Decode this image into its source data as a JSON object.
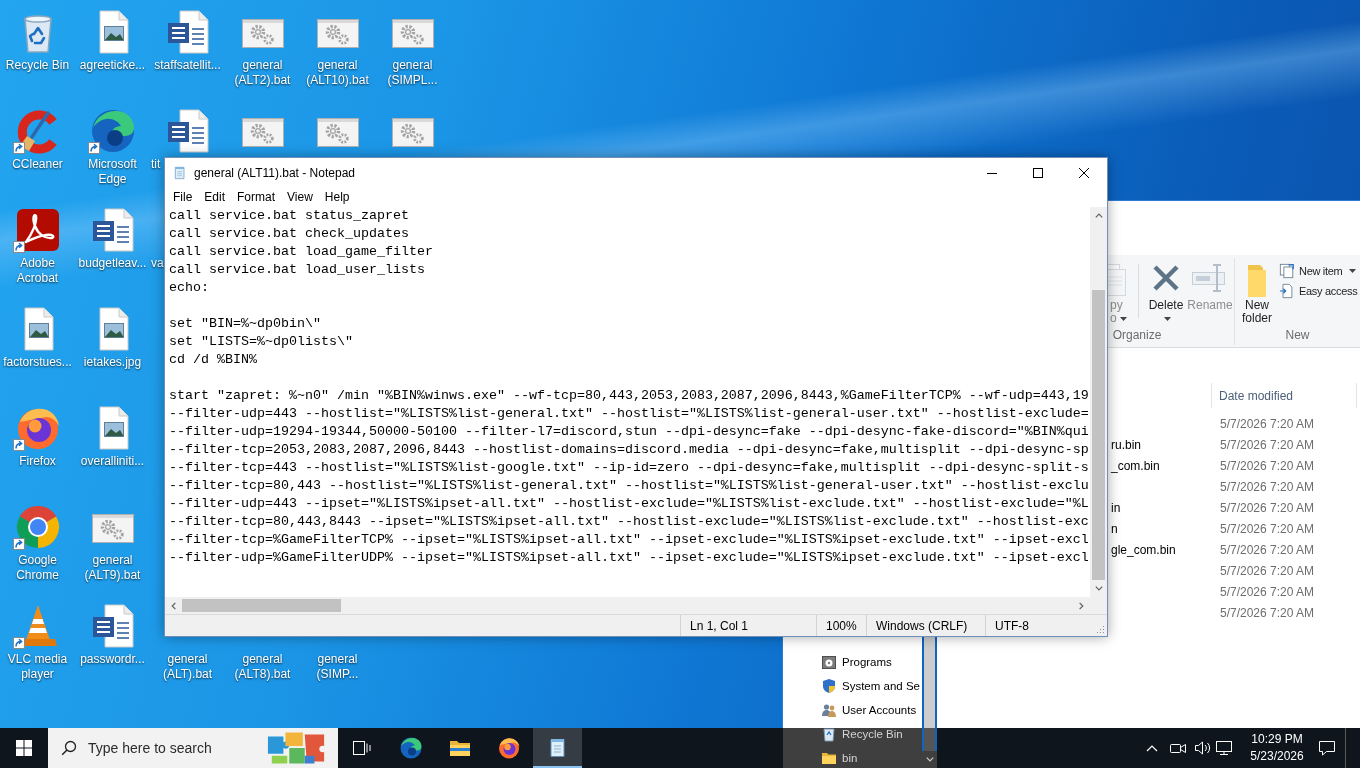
{
  "desktop": {
    "rows": [
      [
        {
          "label": "Recycle Bin",
          "kind": "recycle-bin",
          "shortcut": false,
          "clipped": false
        },
        {
          "label": "agreeticke...",
          "kind": "image",
          "shortcut": false,
          "clipped": false
        },
        {
          "label": "staffsatellit...",
          "kind": "word",
          "shortcut": false,
          "clipped": false
        },
        {
          "label": "general (ALT2).bat",
          "kind": "batch",
          "shortcut": false,
          "clipped": false
        },
        {
          "label": "general (ALT10).bat",
          "kind": "batch",
          "shortcut": false,
          "clipped": false
        },
        {
          "label": "general (SIMPL...",
          "kind": "batch",
          "shortcut": false,
          "clipped": false
        }
      ],
      [
        {
          "label": "CCleaner",
          "kind": "ccleaner",
          "shortcut": true,
          "clipped": false
        },
        {
          "label": "Microsoft Edge",
          "kind": "edge",
          "shortcut": true,
          "clipped": false
        },
        {
          "label": "tit",
          "kind": "word",
          "shortcut": false,
          "clipped": true
        },
        {
          "kind": "batch",
          "shortcut": false
        },
        {
          "kind": "batch",
          "shortcut": false
        },
        {
          "kind": "batch",
          "shortcut": false
        }
      ],
      [
        {
          "label": "Adobe Acrobat",
          "kind": "acrobat",
          "shortcut": true,
          "clipped": false
        },
        {
          "label": "budgetleav...",
          "kind": "word",
          "shortcut": false,
          "clipped": false
        },
        {
          "label": "va",
          "clipped": true
        }
      ],
      [
        {
          "label": "factorstues...",
          "kind": "image",
          "shortcut": false,
          "clipped": false
        },
        {
          "label": "ietakes.jpg",
          "kind": "image",
          "shortcut": false,
          "clipped": false
        }
      ],
      [
        {
          "label": "Firefox",
          "kind": "firefox",
          "shortcut": true,
          "clipped": false
        },
        {
          "label": "overalliniti...",
          "kind": "image",
          "shortcut": false,
          "clipped": false
        }
      ],
      [
        {
          "label": "Google Chrome",
          "kind": "chrome",
          "shortcut": true,
          "clipped": false
        },
        {
          "label": "general (ALT9).bat",
          "kind": "batch",
          "shortcut": false,
          "clipped": false
        }
      ],
      [
        {
          "label": "VLC media player",
          "kind": "vlc",
          "shortcut": true,
          "clipped": false
        },
        {
          "label": "passwordr...",
          "kind": "word",
          "shortcut": false,
          "clipped": false
        },
        {
          "label": "general (ALT).bat",
          "clipped": false
        },
        {
          "label": "general (ALT8).bat",
          "clipped": false
        },
        {
          "label": "general (SIMP...",
          "clipped": false
        }
      ]
    ]
  },
  "explorer": {
    "ribbon": {
      "groups": [
        {
          "label": "Organize",
          "items": [
            {
              "kind": "copy-to",
              "label": "py o",
              "dropdown": true,
              "disabled": true
            },
            {
              "kind": "delete",
              "label": "Delete",
              "dropdown": true,
              "disabled": false
            },
            {
              "kind": "rename",
              "label": "Rename",
              "dropdown": false,
              "disabled": true
            }
          ]
        },
        {
          "label": "New",
          "items": [
            {
              "kind": "new-folder",
              "label": "New folder",
              "dropdown": false,
              "disabled": false
            }
          ],
          "small_items": [
            {
              "kind": "new-item",
              "label": "New item",
              "dropdown": true
            },
            {
              "kind": "easy-access",
              "label": "Easy access",
              "dropdown": false
            }
          ]
        }
      ]
    },
    "nav_pane": {
      "items": [
        {
          "label": "Programs",
          "kind": "programs"
        },
        {
          "label": "System and Se",
          "kind": "shield"
        },
        {
          "label": "User Accounts",
          "kind": "users"
        },
        {
          "label": "Recycle Bin",
          "kind": "recycle-bin"
        },
        {
          "label": "bin",
          "kind": "folder"
        }
      ]
    },
    "file_list": {
      "column_header": "Date modified",
      "rows": [
        {
          "date_modified": "5/7/2026 7:20 AM"
        },
        {
          "name": "ru.bin",
          "date_modified": "5/7/2026 7:20 AM"
        },
        {
          "name": "_com.bin",
          "date_modified": "5/7/2026 7:20 AM"
        },
        {
          "date_modified": "5/7/2026 7:20 AM"
        },
        {
          "name": "in",
          "date_modified": "5/7/2026 7:20 AM"
        },
        {
          "name": "n",
          "date_modified": "5/7/2026 7:20 AM"
        },
        {
          "name": "gle_com.bin",
          "date_modified": "5/7/2026 7:20 AM"
        },
        {
          "date_modified": "5/7/2026 7:20 AM"
        },
        {
          "date_modified": "5/7/2026 7:20 AM"
        },
        {
          "date_modified": "5/7/2026 7:20 AM"
        }
      ]
    }
  },
  "notepad": {
    "title": "general (ALT11).bat - Notepad",
    "menu": [
      "File",
      "Edit",
      "Format",
      "View",
      "Help"
    ],
    "content": "call service.bat status_zapret\ncall service.bat check_updates\ncall service.bat load_game_filter\ncall service.bat load_user_lists\necho:\n\nset \"BIN=%~dp0bin\\\"\nset \"LISTS=%~dp0lists\\\"\ncd /d %BIN%\n\nstart \"zapret: %~n0\" /min \"%BIN%winws.exe\" --wf-tcp=80,443,2053,2083,2087,2096,8443,%GameFilterTCP% --wf-udp=443,19\n--filter-udp=443 --hostlist=\"%LISTS%list-general.txt\" --hostlist=\"%LISTS%list-general-user.txt\" --hostlist-exclude=\n--filter-udp=19294-19344,50000-50100 --filter-l7=discord,stun --dpi-desync=fake --dpi-desync-fake-discord=\"%BIN%qui\n--filter-tcp=2053,2083,2087,2096,8443 --hostlist-domains=discord.media --dpi-desync=fake,multisplit --dpi-desync-sp\n--filter-tcp=443 --hostlist=\"%LISTS%list-google.txt\" --ip-id=zero --dpi-desync=fake,multisplit --dpi-desync-split-s\n--filter-tcp=80,443 --hostlist=\"%LISTS%list-general.txt\" --hostlist=\"%LISTS%list-general-user.txt\" --hostlist-exclu\n--filter-udp=443 --ipset=\"%LISTS%ipset-all.txt\" --hostlist-exclude=\"%LISTS%list-exclude.txt\" --hostlist-exclude=\"%L\n--filter-tcp=80,443,8443 --ipset=\"%LISTS%ipset-all.txt\" --hostlist-exclude=\"%LISTS%list-exclude.txt\" --hostlist-exc\n--filter-tcp=%GameFilterTCP% --ipset=\"%LISTS%ipset-all.txt\" --ipset-exclude=\"%LISTS%ipset-exclude.txt\" --ipset-excl\n--filter-udp=%GameFilterUDP% --ipset=\"%LISTS%ipset-all.txt\" --ipset-exclude=\"%LISTS%ipset-exclude.txt\" --ipset-excl",
    "status": [
      "Ln 1, Col 1",
      "100%",
      "Windows (CRLF)",
      "UTF-8"
    ]
  },
  "taskbar": {
    "search": {
      "placeholder": "Type here to search"
    },
    "apps": [
      {
        "kind": "edge",
        "active": false
      },
      {
        "kind": "explorer",
        "active": false
      },
      {
        "kind": "firefox",
        "active": false
      },
      {
        "kind": "notepad",
        "active": true
      }
    ],
    "clock": {
      "time": "10:29 PM",
      "date": "5/23/2026"
    }
  }
}
